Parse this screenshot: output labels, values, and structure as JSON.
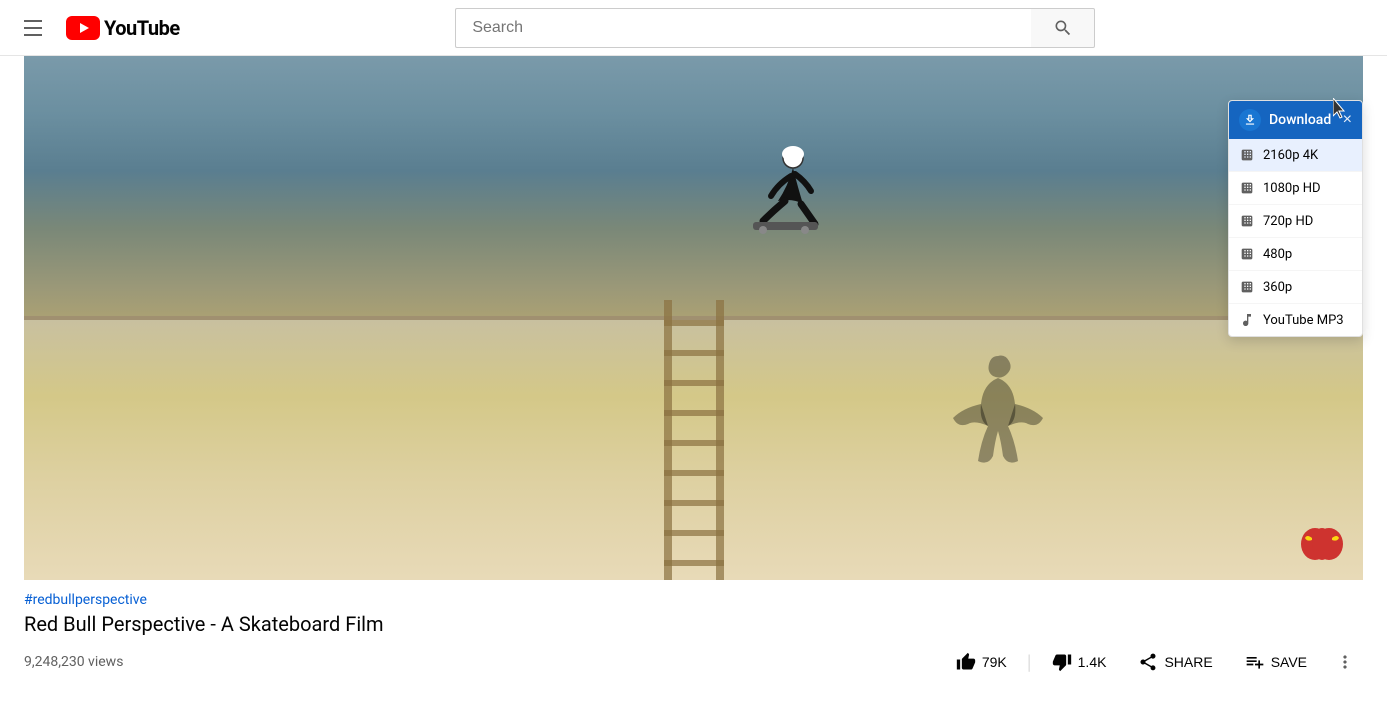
{
  "header": {
    "search_placeholder": "Search",
    "youtube_text": "YouTube"
  },
  "download_dropdown": {
    "title": "Download",
    "close_label": "×",
    "options": [
      {
        "id": "2160p",
        "label": "2160p 4K",
        "icon": "film",
        "highlighted": true
      },
      {
        "id": "1080p",
        "label": "1080p HD",
        "icon": "film",
        "highlighted": false
      },
      {
        "id": "720p",
        "label": "720p HD",
        "icon": "film",
        "highlighted": false
      },
      {
        "id": "480p",
        "label": "480p",
        "icon": "film",
        "highlighted": false
      },
      {
        "id": "360p",
        "label": "360p",
        "icon": "film",
        "highlighted": false
      },
      {
        "id": "mp3",
        "label": "YouTube MP3",
        "icon": "music",
        "highlighted": false
      }
    ]
  },
  "video": {
    "hashtag": "#redbullperspective",
    "title": "Red Bull Perspective - A Skateboard Film",
    "views": "9,248,230 views",
    "likes": "79K",
    "dislikes": "1.4K",
    "share_label": "SHARE",
    "save_label": "SAVE"
  },
  "actions": {
    "like_label": "79K",
    "dislike_label": "1.4K",
    "share_label": "SHARE",
    "save_label": "SAVE"
  }
}
